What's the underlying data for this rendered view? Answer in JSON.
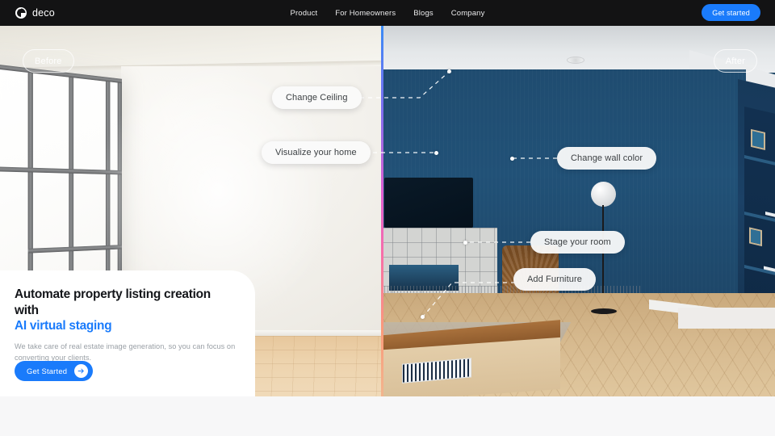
{
  "nav": {
    "brand": "deco",
    "brand_icon": "deco-swirl-logo-icon",
    "links": [
      {
        "label": "Product"
      },
      {
        "label": "For Homeowners"
      },
      {
        "label": "Blogs"
      },
      {
        "label": "Company"
      }
    ],
    "cta_label": "Get started",
    "background": "#131314",
    "accent": "#1a7bfb"
  },
  "hero": {
    "badges": {
      "before": "Before",
      "after": "After"
    },
    "pills": [
      {
        "key": "ceiling",
        "label": "Change Ceiling"
      },
      {
        "key": "visualize",
        "label": "Visualize your home"
      },
      {
        "key": "wallcolor",
        "label": "Change wall color"
      },
      {
        "key": "stage",
        "label": "Stage your room"
      },
      {
        "key": "furniture",
        "label": "Add Furniture"
      }
    ],
    "card": {
      "title_line1": "Automate property listing creation with",
      "title_line2": "AI virtual staging",
      "subtitle": "We take care of real estate image generation, so you can focus on converting your clients.",
      "button_label": "Get Started",
      "button_icon": "arrow-right-icon",
      "accent": "#1a7bfb"
    },
    "divider": {
      "name": "before-after-slider",
      "gradient": [
        "#3a8bf5",
        "#7a6ef0",
        "#e05fd0",
        "#f76fa8",
        "#fa9a7a"
      ]
    },
    "before_image": {
      "alt": "empty unfurnished room with large window and light wood floor"
    },
    "after_image": {
      "alt": "staged living room with dark blue walls, built-in shelving, tiled fireplace, TV, floor lamp, coffee table and herringbone wood floor"
    }
  }
}
